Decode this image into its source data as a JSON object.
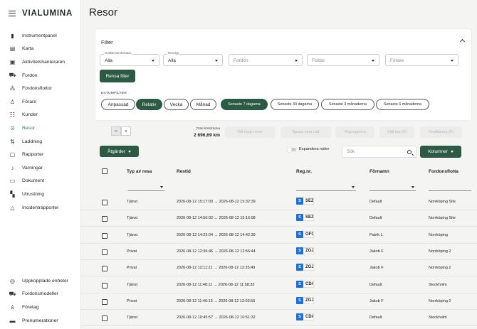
{
  "app": {
    "logo": "VIALUMINA"
  },
  "sidebar": {
    "items": [
      {
        "label": "Instrumentpanel",
        "icon": "bar-chart-icon"
      },
      {
        "label": "Karta",
        "icon": "map-icon"
      },
      {
        "label": "Aktivitetshanteraren",
        "icon": "activity-icon"
      },
      {
        "label": "Fordon",
        "icon": "truck-icon"
      },
      {
        "label": "Fordonsflottor",
        "icon": "fleet-icon"
      },
      {
        "label": "Förare",
        "icon": "person-icon"
      },
      {
        "label": "Kunder",
        "icon": "customers-icon"
      },
      {
        "label": "Resor",
        "icon": "location-pin-icon",
        "active": true
      },
      {
        "label": "Laddning",
        "icon": "charging-icon"
      },
      {
        "label": "Rapporter",
        "icon": "report-icon"
      },
      {
        "label": "Varningar",
        "icon": "bell-icon"
      },
      {
        "label": "Dokument",
        "icon": "folder-icon"
      },
      {
        "label": "Utrustning",
        "icon": "equipment-icon"
      },
      {
        "label": "Incidentrapporter",
        "icon": "warning-icon"
      }
    ],
    "bottom_items": [
      {
        "label": "Uppkopplade enheter",
        "icon": "connected-icon"
      },
      {
        "label": "Fordonsmodeller",
        "icon": "car-icon"
      },
      {
        "label": "Företag",
        "icon": "company-icon"
      },
      {
        "label": "Prenumerationer",
        "icon": "subscription-icon"
      }
    ]
  },
  "page": {
    "title": "Resor"
  },
  "filter": {
    "title": "Filter",
    "selects": [
      {
        "label": "Godkännandestatus",
        "value": "Alla"
      },
      {
        "label": "Resetyp",
        "value": "Alla"
      },
      {
        "label": "",
        "value": "Fordon"
      },
      {
        "label": "",
        "value": "Flottor"
      },
      {
        "label": "",
        "value": "Förare"
      }
    ],
    "clear_label": "Rensa filter",
    "date_filter_label": "DATUMFILTER",
    "date_modes": [
      "Anpassad",
      "Relativ",
      "Vecka",
      "Månad"
    ],
    "active_mode": "Relativ",
    "ranges": [
      "Senaste 7 dagarna",
      "Senaste 30 dagarna",
      "Senaste 3 månaderna",
      "Senaste 6 månaderna"
    ],
    "active_range": "Senaste 7 dagarna"
  },
  "toolbar": {
    "total_label": "Total körsträcka",
    "total_value": "2 696,69 km",
    "buttons": [
      "Slå ihop resor",
      "Spara som rutt",
      "Avgruppera",
      "Välj typ (0)",
      "Godkänna (0)"
    ],
    "actions_label": "Åtgärder",
    "expand_label": "Expandera rutter",
    "search_placeholder": "Sök",
    "columns_label": "Kolumner"
  },
  "table": {
    "headers": [
      "Typ av resa",
      "Restid",
      "Reg.nr.",
      "Förnamn",
      "Fordonsflotta"
    ],
    "plate_prefix": "S",
    "rows": [
      {
        "type": "Tjänst",
        "time": "2026-08-12 15:17:00 → 2026-08-12 15:32:39",
        "plate": "SEZ",
        "name": "Default",
        "fleet": "Norrköping Site"
      },
      {
        "type": "Tjänst",
        "time": "2026-08-12 14:50:02 → 2026-08-12 15:16:08",
        "plate": "SEZ",
        "name": "Default",
        "fleet": "Norrköping Site"
      },
      {
        "type": "Tjänst",
        "time": "2026-08-12 14:23:04 → 2026-08-12 14:42:39",
        "plate": "OFG",
        "name": "Patrik L",
        "fleet": "Norrköping"
      },
      {
        "type": "Privat",
        "time": "2026-08-12 12:36:46 → 2026-08-12 12:56:44",
        "plate": "ZGJ",
        "name": "Jakob F",
        "fleet": "Norrköping 2"
      },
      {
        "type": "Privat",
        "time": "2026-08-12 12:11:21 → 2026-08-12 12:35:49",
        "plate": "ZGJ",
        "name": "Jakob F",
        "fleet": "Norrköping 2"
      },
      {
        "type": "Tjänst",
        "time": "2026-08-12 11:48:11 → 2026-08-12 11:58:33",
        "plate": "CDA",
        "name": "Default",
        "fleet": "Stockholm"
      },
      {
        "type": "Privat",
        "time": "2026-08-12 11:46:13 → 2026-08-12 12:03:56",
        "plate": "ZGJ",
        "name": "Jakob F",
        "fleet": "Norrköping 2"
      },
      {
        "type": "Tjänst",
        "time": "2026-08-12 10:45:57 → 2026-08-12 10:51:32",
        "plate": "CDA",
        "name": "Default",
        "fleet": "Stockholm"
      }
    ]
  },
  "colors": {
    "primary": "#2c5a43",
    "active_nav": "#2d7a4f",
    "plate_blue": "#1e6fd9"
  }
}
